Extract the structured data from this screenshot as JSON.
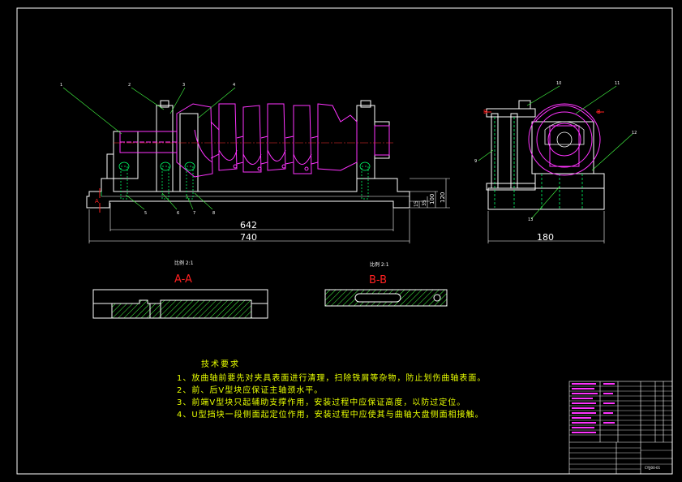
{
  "view_labels": {
    "section_aa": "A-A",
    "section_bb": "B-B",
    "scale_aa": "比例 2:1",
    "scale_bb": "比例 2:1",
    "left_a": "A",
    "right_b1": "B",
    "right_b2": "B"
  },
  "dimensions": {
    "d642": "642",
    "d740": "740",
    "d180": "180",
    "d120": "120",
    "d100": "100",
    "d35": "35",
    "d15": "15"
  },
  "part_numbers": [
    "1",
    "2",
    "3",
    "4",
    "5",
    "6",
    "7",
    "8",
    "9",
    "10",
    "11",
    "12",
    "13"
  ],
  "notes": {
    "title": "技术要求",
    "items": [
      "1、放曲轴前要先对夹具表面进行清理，扫除铁屑等杂物，防止划伤曲轴表面。",
      "2、前、后V型块应保证主轴颈水平。",
      "3、前端V型块只起辅助支撑作用，安装过程中应保证高度，以防过定位。",
      "4、U型挡块一段侧面起定位作用，安装过程中应使其与曲轴大盘侧面相接触。"
    ]
  },
  "title_block": {
    "drawing_code": "CYJJ00-01"
  },
  "colors": {
    "background": "#000000",
    "outline": "#ffffff",
    "hidden": "#00ff66",
    "crankshaft": "#ff33ff",
    "leader": "#44ff44",
    "section_title": "#ff2020",
    "notes_text": "#e8ff00",
    "hatch": "#44ff44"
  }
}
